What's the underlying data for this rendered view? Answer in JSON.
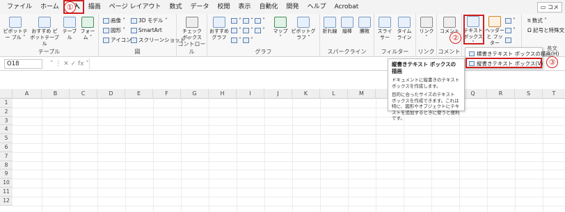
{
  "menu": {
    "items": [
      "ファイル",
      "ホーム",
      "挿入",
      "描画",
      "ページ レイアウト",
      "数式",
      "データ",
      "校閲",
      "表示",
      "自動化",
      "開発",
      "ヘルプ",
      "Acrobat"
    ],
    "comment_label": "コメ"
  },
  "ribbon": {
    "table_group": {
      "label": "テーブル",
      "pivot_label": "ピボットテー ブル ˅",
      "recommended_label": "おすすめ ピボットテーブル",
      "table_label": "テーブル",
      "form_label": "フォー ム ˅"
    },
    "illustrations_group": {
      "label": "図",
      "image_label": "画像 ˅",
      "shapes_label": "図形 ˅",
      "icons_label": "アイコン",
      "model3d_label": "3D モデル ˅",
      "smartart_label": "SmartArt",
      "screenshot_label": "スクリーンショット ˅"
    },
    "controls_group": {
      "label": "コントロール",
      "checkbox_label": "チェック ボックス"
    },
    "charts_group": {
      "label": "グラフ",
      "recommended_label": "おすすめ グラフ",
      "map_label": "マップ ˅",
      "pivotchart_label": "ピボットグラフ ˅"
    },
    "sparklines_group": {
      "label": "スパークライン",
      "line_label": "折れ線",
      "column_label": "縦棒",
      "winloss_label": "勝敗"
    },
    "filters_group": {
      "label": "フィルター",
      "slicer_label": "スライサー",
      "timeline_label": "タイム ライン"
    },
    "links_group": {
      "label": "リンク",
      "link_label": "リンク ˅"
    },
    "comments_group": {
      "label": "コメント",
      "comment_label": "コメント"
    },
    "text_group": {
      "textbox_label": "テキスト ボックス ˅",
      "header_label": "ヘッダーと フッター",
      "wordart_label": "",
      "fragment_label": "長文"
    },
    "symbols_group": {
      "equation_label": "π 数式 ˅",
      "symbol_label": "Ω 記号と特殊文"
    }
  },
  "annotations": {
    "step1": "①",
    "step2": "②",
    "step3": "③"
  },
  "formula_bar": {
    "name_box": "O18",
    "fx_label": "˅ ⋮ ✕ ✓ fx ˅"
  },
  "columns": [
    "A",
    "B",
    "C",
    "D",
    "E",
    "F",
    "G",
    "H",
    "I",
    "J",
    "K",
    "L",
    "M",
    "N",
    "O",
    "P",
    "Q",
    "R",
    "S",
    "T"
  ],
  "rows": [
    "1",
    "2",
    "3",
    "4",
    "5",
    "6",
    "7",
    "8",
    "9",
    "10",
    "11",
    "12"
  ],
  "dropdown": {
    "items": [
      "横書きテキスト ボックスの描画(H)",
      "縦書きテキスト ボックス(V)"
    ]
  },
  "tooltip": {
    "title": "縦書きテキスト ボックスの描画",
    "body1": "ドキュメントに縦書きのテキスト ボックスを作成します。",
    "body2": "目的に合ったサイズのテキスト ボックスを作成できます。これは特に、図形やオブジェクトにテキストを追加するときに使うと便利です。"
  }
}
